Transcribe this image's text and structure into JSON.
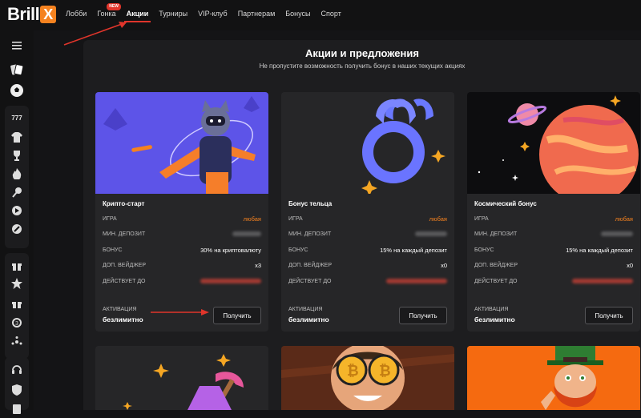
{
  "logo": {
    "text": "Brill",
    "x": "X"
  },
  "nav": {
    "items": [
      {
        "label": "Лобби"
      },
      {
        "label": "Гонка",
        "badge": "NEW"
      },
      {
        "label": "Акции",
        "active": true
      },
      {
        "label": "Турниры"
      },
      {
        "label": "VIP-клуб"
      },
      {
        "label": "Партнерам"
      },
      {
        "label": "Бонусы"
      },
      {
        "label": "Спорт"
      }
    ]
  },
  "sidebar": {
    "icons": [
      "menu-icon",
      "cards-icon",
      "soccer-ball-icon",
      "777-icon",
      "jersey-icon",
      "trophy-icon",
      "fire-icon",
      "pin-icon",
      "live-icon",
      "rocket-icon",
      "gift-icon",
      "star-icon",
      "gift-small-icon",
      "spin-icon",
      "burst-icon",
      "headset-icon",
      "shield-icon",
      "document-icon"
    ]
  },
  "main": {
    "title": "Акции и предложения",
    "subtitle": "Не пропустите возможность получить бонус в наших текущих акциях"
  },
  "labels": {
    "game": "ИГРА",
    "min_deposit": "МИН. ДЕПОЗИТ",
    "bonus": "БОНУС",
    "wager": "ДОП. ВЕЙДЖЕР",
    "valid_until": "ДЕЙСТВУЕТ ДО",
    "activation": "АКТИВАЦИЯ"
  },
  "cards": [
    {
      "title": "Крипто-старт",
      "game": "любая",
      "bonus": "30% на криптовалюту",
      "wager": "x3",
      "activation": "безлимитно",
      "button": "Получить"
    },
    {
      "title": "Бонус тельца",
      "game": "любая",
      "bonus": "15% на каждый депозит",
      "wager": "x0",
      "activation": "безлимитно",
      "button": "Получить"
    },
    {
      "title": "Космический бонус",
      "game": "любая",
      "bonus": "15% на каждый депозит",
      "wager": "x0",
      "activation": "безлимитно",
      "button": "Получить"
    }
  ],
  "colors": {
    "accent": "#f5821f",
    "red": "#e0352b",
    "bg": "#141416",
    "panel": "#1d1d1f",
    "card": "#262628"
  }
}
